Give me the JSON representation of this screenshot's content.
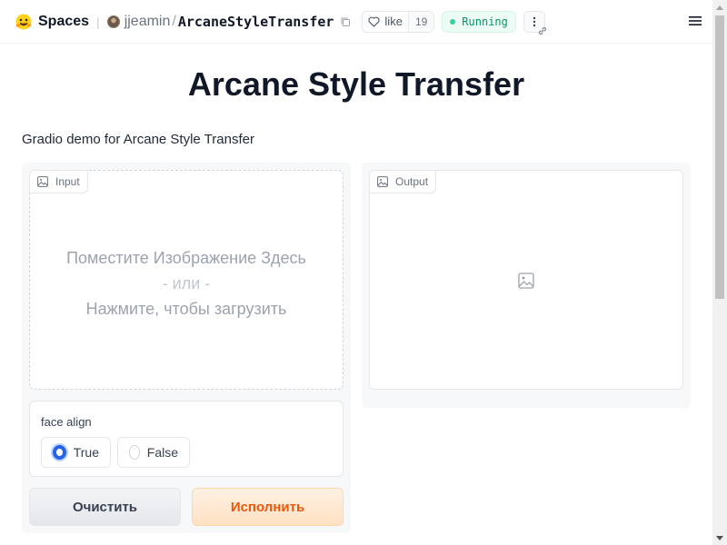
{
  "header": {
    "spaces_label": "Spaces",
    "owner": "jjeamin",
    "separator": "/",
    "repo_name": "ArcaneStyleTransfer",
    "like_label": "like",
    "like_count": "19",
    "status": "Running",
    "status_color": "#059669",
    "icons": [
      "huggingface-logo-icon",
      "copy-icon",
      "heart-icon",
      "kebab-menu-icon",
      "link-icon",
      "hamburger-menu-icon"
    ]
  },
  "page": {
    "title": "Arcane Style Transfer",
    "description": "Gradio demo for Arcane Style Transfer"
  },
  "input": {
    "label": "Input",
    "drop_text": "Поместите Изображение Здесь",
    "or_text": "- или -",
    "click_text": "Нажмите, чтобы загрузить"
  },
  "output": {
    "label": "Output"
  },
  "face_align": {
    "label": "face align",
    "options": [
      "True",
      "False"
    ],
    "selected": "True",
    "accent": "#2563eb"
  },
  "buttons": {
    "clear": "Очистить",
    "submit": "Исполнить",
    "submit_color": "#ea580c"
  }
}
